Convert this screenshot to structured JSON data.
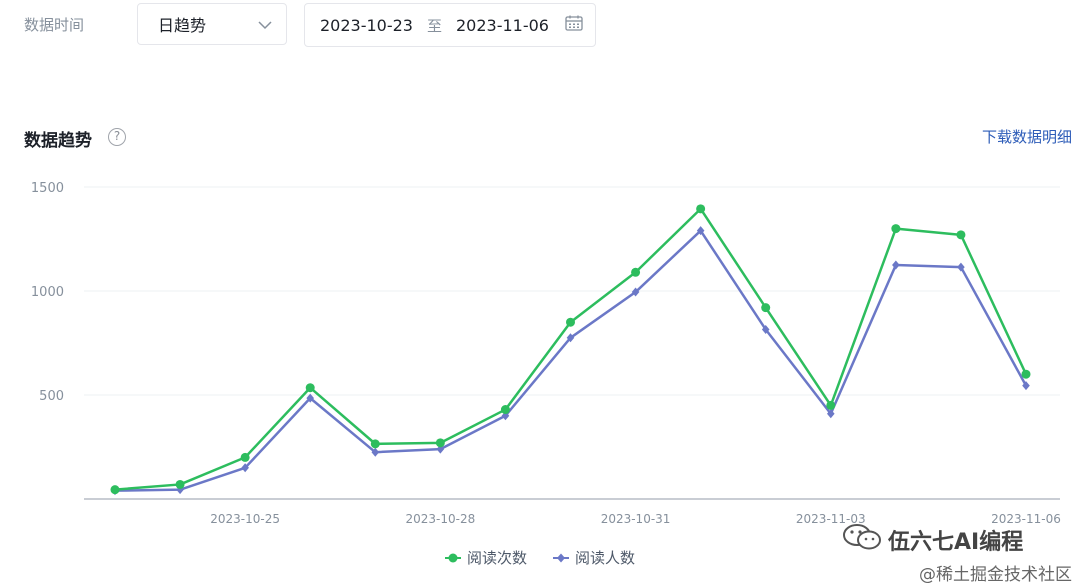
{
  "filters": {
    "time_label": "数据时间",
    "granularity": "日趋势",
    "date_start": "2023-10-23",
    "date_sep": "至",
    "date_end": "2023-11-06"
  },
  "section": {
    "title": "数据趋势",
    "help_symbol": "?",
    "download_label": "下载数据明细"
  },
  "watermark": {
    "line1": "伍六七AI编程",
    "line2": "@稀土掘金技术社区"
  },
  "chart_data": {
    "type": "line",
    "x": [
      "2023-10-23",
      "2023-10-24",
      "2023-10-25",
      "2023-10-26",
      "2023-10-27",
      "2023-10-28",
      "2023-10-29",
      "2023-10-30",
      "2023-10-31",
      "2023-11-01",
      "2023-11-02",
      "2023-11-03",
      "2023-11-04",
      "2023-11-05",
      "2023-11-06"
    ],
    "x_tick_labels": [
      "2023-10-25",
      "2023-10-28",
      "2023-10-31",
      "2023-11-03",
      "2023-11-06"
    ],
    "y_ticks": [
      "500",
      "1000",
      "1500"
    ],
    "ylim": [
      0,
      1500
    ],
    "grid": true,
    "legend_position": "bottom",
    "series": [
      {
        "name": "阅读次数",
        "color": "#2dbd5e",
        "marker": "circle",
        "values": [
          45,
          70,
          200,
          535,
          265,
          270,
          430,
          850,
          1090,
          1395,
          920,
          450,
          1300,
          1270,
          600
        ]
      },
      {
        "name": "阅读人数",
        "color": "#6b78c7",
        "marker": "diamond",
        "values": [
          40,
          45,
          150,
          485,
          225,
          240,
          400,
          775,
          995,
          1290,
          815,
          410,
          1125,
          1115,
          545
        ]
      }
    ]
  }
}
